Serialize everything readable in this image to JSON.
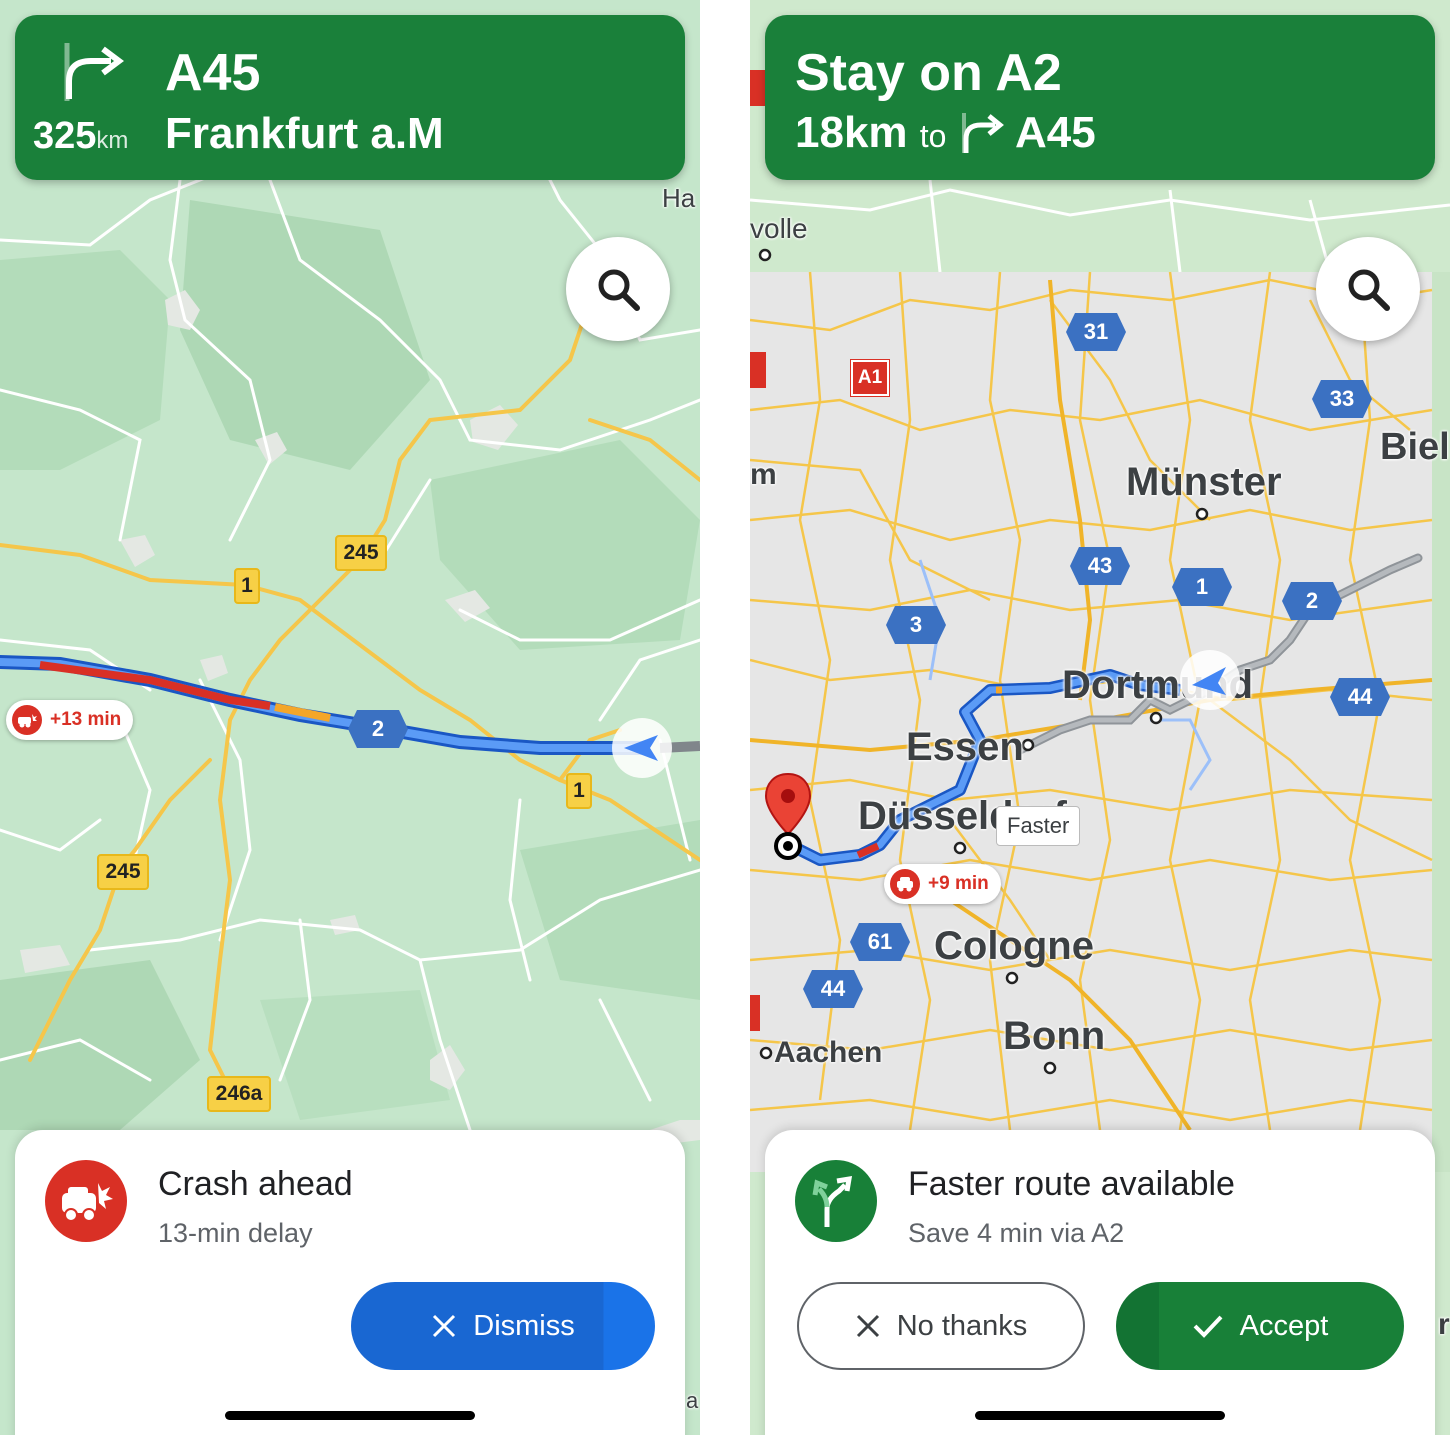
{
  "left": {
    "header": {
      "road": "A45",
      "distance_value": "325",
      "distance_unit": "km",
      "destination": "Frankfurt a.M"
    },
    "map": {
      "edge_label": "Ha",
      "road_badges": [
        "245",
        "1",
        "2",
        "1",
        "245",
        "246a"
      ],
      "delay_text": "+13 min",
      "bottom_edge_label": "a"
    },
    "alert": {
      "title": "Crash ahead",
      "subtitle": "13-min delay",
      "dismiss_label": "Dismiss"
    },
    "icons": [
      "turn-right-icon",
      "search-icon",
      "crash-icon",
      "close-icon",
      "navigation-arrow-icon"
    ],
    "colors": {
      "header_green": "#1a803a",
      "route_blue": "#4285f4",
      "dismiss_blue": "#1967d2",
      "traffic_red": "#d93025"
    }
  },
  "right": {
    "header": {
      "instruction": "Stay on A2",
      "distance": "18km",
      "to_word": "to",
      "road": "A45"
    },
    "map": {
      "cities": [
        "Münster",
        "Dortmund",
        "Essen",
        "Düsseldorf",
        "Cologne",
        "Bonn",
        "Aachen"
      ],
      "edge_labels": [
        "volle",
        "Biel",
        "m",
        "r"
      ],
      "road_badges": [
        "31",
        "33",
        "43",
        "1",
        "2",
        "3",
        "44",
        "61",
        "44",
        "A1"
      ],
      "faster_tag": "Faster",
      "delay_text": "+9 min"
    },
    "alert": {
      "title": "Faster route available",
      "subtitle": "Save 4 min via A2",
      "decline_label": "No thanks",
      "accept_label": "Accept"
    },
    "icons": [
      "turn-right-icon",
      "search-icon",
      "fork-route-icon",
      "close-icon",
      "check-icon",
      "destination-pin-icon"
    ],
    "colors": {
      "header_green": "#1a803a",
      "accept_green": "#188038"
    }
  }
}
